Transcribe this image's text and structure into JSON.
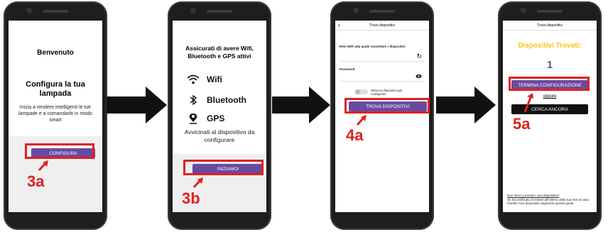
{
  "screens": [
    {
      "title": "Benvenuto",
      "subtitle": "Configura la tua lampada",
      "body": "Inizia a rendere intelligenti le tue lampade e a comandarle in modo smart",
      "button": "CONFIGURA",
      "step": "3a"
    },
    {
      "title": "Assicurati di avere Wifi, Bluetooth e GPS attivi",
      "features": [
        {
          "icon": "wifi-icon",
          "label": "Wifi"
        },
        {
          "icon": "bluetooth-icon",
          "label": "Bluetooth"
        },
        {
          "icon": "location-pin-icon",
          "label": "GPS"
        }
      ],
      "hint": "Avvicinati al dispositivo da configurare",
      "button": "INIZIAMO!",
      "step": "3b"
    },
    {
      "header": "Trova dispositivi",
      "network_label": "Rete WiFi alla quale connettere i dispositivi",
      "password_label": "Password",
      "toggle_label": "Sblocca dispositivi già configurati",
      "button": "TROVA DISPOSITIVI",
      "step": "4a"
    },
    {
      "header": "Trova dispositivi",
      "found_title": "Dispositivi Trovati:",
      "found_count": "1",
      "finish_button": "TERMINA CONFIGURAZIONE",
      "or": "oppure",
      "search_again": "CERCA ANCORA",
      "footer_link": "Non riesci a trovare i tuoi dispositivi?",
      "footer_text": "Se hai verificato di essere all'interno della tua rete di casa resetta i tuoi dispositivi seguendo questa guida",
      "step": "5a"
    }
  ],
  "colors": {
    "accent": "#6a4aa0",
    "highlight": "#e02020",
    "found": "#f5c518"
  }
}
